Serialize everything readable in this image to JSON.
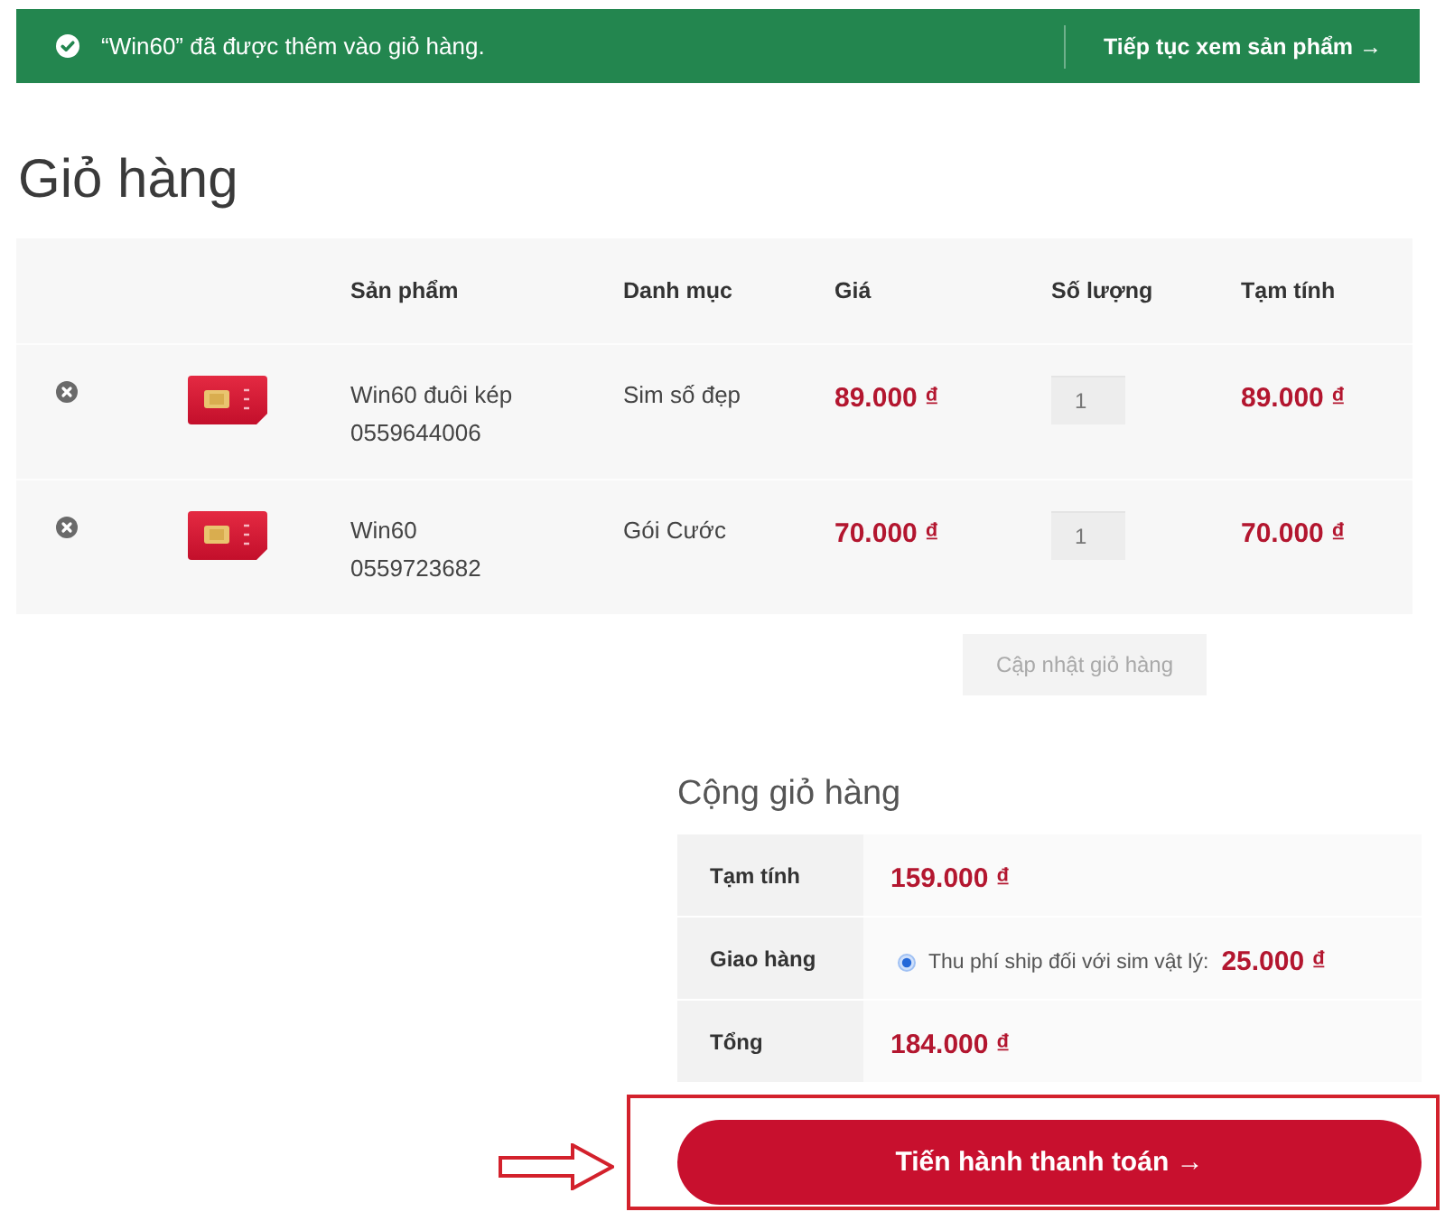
{
  "notice": {
    "message": "“Win60” đã được thêm vào giỏ hàng.",
    "link": "Tiếp tục xem sản phẩm →"
  },
  "title": "Giỏ hàng",
  "cart": {
    "columns": [
      "Sản phẩm",
      "Danh mục",
      "Giá",
      "Số lượng",
      "Tạm tính"
    ],
    "rows": [
      {
        "name": "Win60 đuôi kép",
        "number": "0559644006",
        "category": "Sim số đẹp",
        "price": "89.000 ₫",
        "quantity": "1",
        "subtotal": "89.000 ₫"
      },
      {
        "name": "Win60",
        "number": "0559723682",
        "category": "Gói Cước",
        "price": "70.000 ₫",
        "quantity": "1",
        "subtotal": "70.000 ₫"
      }
    ]
  },
  "update_button": {
    "label": "Cập nhật giỏ hàng",
    "disabled": true
  },
  "totals": {
    "title": "Cộng giỏ hàng",
    "rows": [
      {
        "kind": "amount",
        "label": "Tạm tính",
        "value": "159.000 ₫"
      },
      {
        "kind": "shipping",
        "label": "Giao hàng",
        "options": [
          {
            "label": "Thu phí ship đối với sim vật lý:",
            "price": "25.000 ₫",
            "selected": true
          }
        ]
      },
      {
        "kind": "amount",
        "label": "Tổng",
        "value": "184.000 ₫"
      }
    ]
  },
  "checkout_button": "Tiến hành thanh toán →"
}
